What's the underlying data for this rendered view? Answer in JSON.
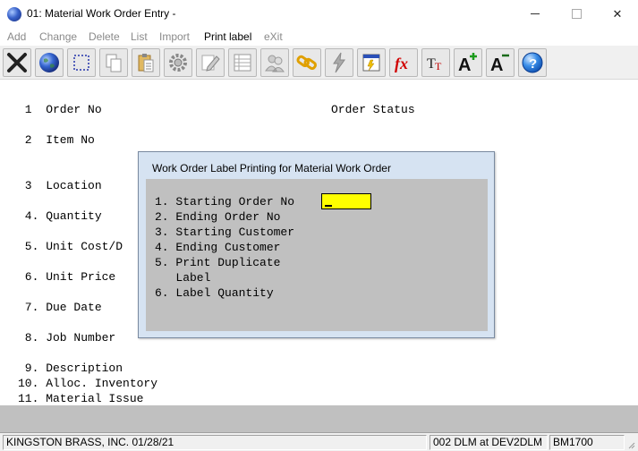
{
  "window": {
    "title": "01: Material Work Order Entry -"
  },
  "menu": [
    {
      "label": "Add",
      "enabled": false
    },
    {
      "label": "Change",
      "enabled": false
    },
    {
      "label": "Delete",
      "enabled": false
    },
    {
      "label": "List",
      "enabled": false
    },
    {
      "label": "Import",
      "enabled": false
    },
    {
      "label": "Print label",
      "enabled": true
    },
    {
      "label": "eXit",
      "enabled": false
    }
  ],
  "toolbar": {
    "buttons": [
      "exit-icon",
      "globe-icon",
      "select-icon",
      "copy-icon",
      "paste-icon",
      "settings-icon",
      "edit-icon",
      "list-icon",
      "users-icon",
      "link-icon",
      "lightning-icon",
      "calculator-icon",
      "function-icon",
      "font-icon",
      "font-increase-icon",
      "font-decrease-icon",
      "help-icon"
    ]
  },
  "form": {
    "order_no": " 1  Order No",
    "order_status": "Order Status",
    "item_no": " 2  Item No",
    "location": " 3  Location",
    "quantity": " 4. Quantity",
    "unit_cost": " 5. Unit Cost/D",
    "unit_price": " 6. Unit Price",
    "due_date": " 7. Due Date",
    "job_number": " 8. Job Number",
    "description": " 9. Description",
    "alloc_inventory": "10. Alloc. Inventory",
    "material_issue": "11. Material Issue"
  },
  "dialog": {
    "title": "Work Order Label Printing for Material Work Order",
    "fields": {
      "f1": "1. Starting Order No",
      "f2": "2. Ending Order No",
      "f3": "3. Starting Customer",
      "f4": "4. Ending Customer",
      "f5": "5. Print Duplicate",
      "f5b": "   Label",
      "f6": "6. Label Quantity"
    },
    "input_value": "",
    "input_color": "#ffff00"
  },
  "status": {
    "company": "KINGSTON BRASS, INC. 01/28/21",
    "session": "002 DLM at DEV2DLM",
    "module": "BM1700"
  }
}
